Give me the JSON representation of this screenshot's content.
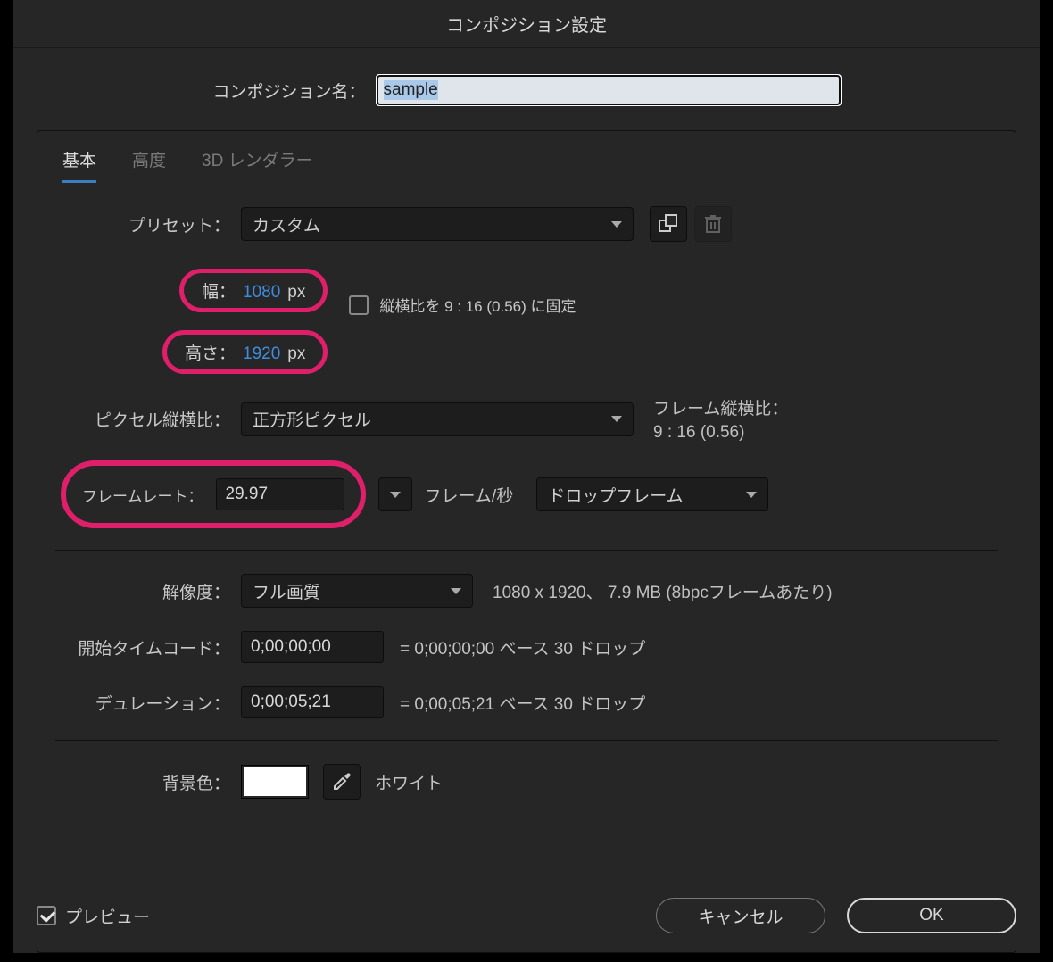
{
  "dialog": {
    "title": "コンポジション設定"
  },
  "nameRow": {
    "label": "コンポジション名：",
    "value": "sample"
  },
  "tabs": {
    "basic": "基本",
    "advanced": "高度",
    "renderer": "3D レンダラー"
  },
  "preset": {
    "label": "プリセット：",
    "value": "カスタム"
  },
  "width": {
    "label": "幅：",
    "value": "1080",
    "unit": "px"
  },
  "height": {
    "label": "高さ：",
    "value": "1920",
    "unit": "px"
  },
  "lockAspect": {
    "label": "縦横比を 9 : 16 (0.56) に固定"
  },
  "pixelAspect": {
    "label": "ピクセル縦横比：",
    "value": "正方形ピクセル"
  },
  "frameAspect": {
    "label": "フレーム縦横比：",
    "value": "9 : 16 (0.56)"
  },
  "frameRate": {
    "label": "フレームレート：",
    "value": "29.97",
    "perSec": "フレーム/秒",
    "drop": "ドロップフレーム"
  },
  "resolution": {
    "label": "解像度：",
    "value": "フル画質",
    "info": "1080 x 1920、 7.9 MB (8bpcフレームあたり)"
  },
  "startTC": {
    "label": "開始タイムコード：",
    "value": "0;00;00;00",
    "info": "= 0;00;00;00  ベース 30  ドロップ"
  },
  "duration": {
    "label": "デュレーション：",
    "value": "0;00;05;21",
    "info": "= 0;00;05;21  ベース 30  ドロップ"
  },
  "bgColor": {
    "label": "背景色：",
    "name": "ホワイト",
    "hex": "#ffffff"
  },
  "footer": {
    "preview": "プレビュー",
    "cancel": "キャンセル",
    "ok": "OK"
  }
}
